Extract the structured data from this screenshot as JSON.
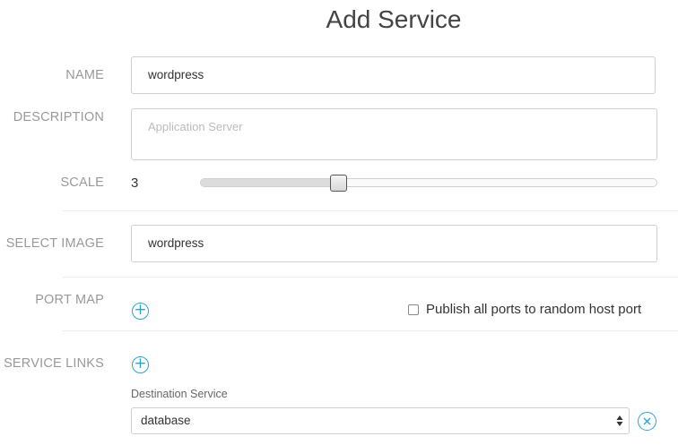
{
  "page": {
    "title": "Add Service"
  },
  "form": {
    "name": {
      "label": "NAME",
      "value": "wordpress"
    },
    "description": {
      "label": "DESCRIPTION",
      "placeholder": "Application Server"
    },
    "scale": {
      "label": "SCALE",
      "value": "3",
      "fraction": 0.3
    },
    "image": {
      "label": "SELECT IMAGE",
      "value": "wordpress"
    },
    "port_map": {
      "label": "PORT MAP",
      "add_icon": "plus-circle-icon",
      "publish_all_label": "Publish all ports to random host port",
      "publish_all_checked": false
    },
    "service_links": {
      "label": "SERVICE LINKS",
      "add_icon": "plus-circle-icon",
      "destination_label": "Destination Service",
      "destination_value": "database",
      "remove_icon": "x-circle-icon"
    }
  },
  "colors": {
    "accent": "#2aa3d3",
    "label": "#999999",
    "border": "#cfcfcf"
  }
}
